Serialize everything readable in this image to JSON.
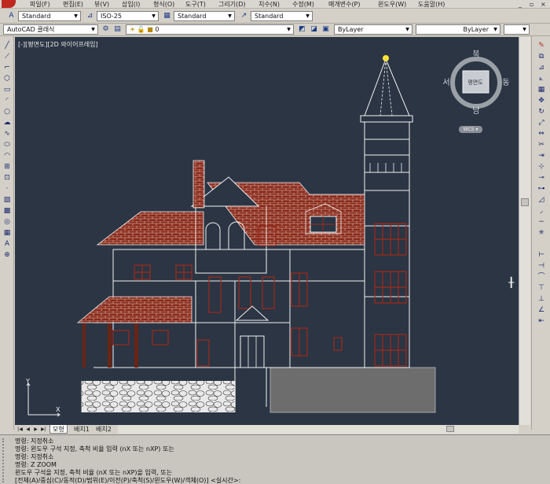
{
  "menubar": {
    "items": [
      "파일(F)",
      "편집(E)",
      "뷰(V)",
      "삽입(I)",
      "형식(O)",
      "도구(T)",
      "그리기(D)",
      "치수(N)",
      "수정(M)",
      "매개변수(P)",
      "윈도우(W)",
      "도움말(H)"
    ]
  },
  "toolbar1": {
    "text_style": "Standard",
    "dim_style": "ISO-25",
    "table_style": "Standard",
    "mleader_style": "Standard"
  },
  "toolbar2": {
    "workspace": "AutoCAD 클래식",
    "layer": "0",
    "color": "ByLayer",
    "linetype": "ByLayer"
  },
  "viewport": {
    "label": "[-][평면도][2D 와이어프레임]",
    "compass": {
      "north": "북",
      "south": "남",
      "east": "동",
      "west": "서",
      "top": "평면도"
    },
    "wcs": "WCS ▾",
    "ucs_x": "X",
    "ucs_y": "Y"
  },
  "layout_tabs": [
    "모형",
    "배치1",
    "배치2"
  ],
  "command_lines": [
    "명령: 지정취소",
    "명령: 윈도우 구석 지정, 축척 비율 입력 (nX 또는 nXP) 또는",
    "명령: 지정취소",
    "명령: Z ZOOM",
    "윈도우 구석을 지정, 축척 비율 (nX 또는 nXP)을 입력, 또는",
    "[전체(A)/중심(C)/동적(D)/범위(E)/이전(P)/축척(S)/윈도우(W)/객체(O)] <실시간>:"
  ],
  "colors": {
    "viewport_bg": "#2b3544",
    "brick": "#8c2a1a",
    "accent_red": "#c0271f"
  }
}
